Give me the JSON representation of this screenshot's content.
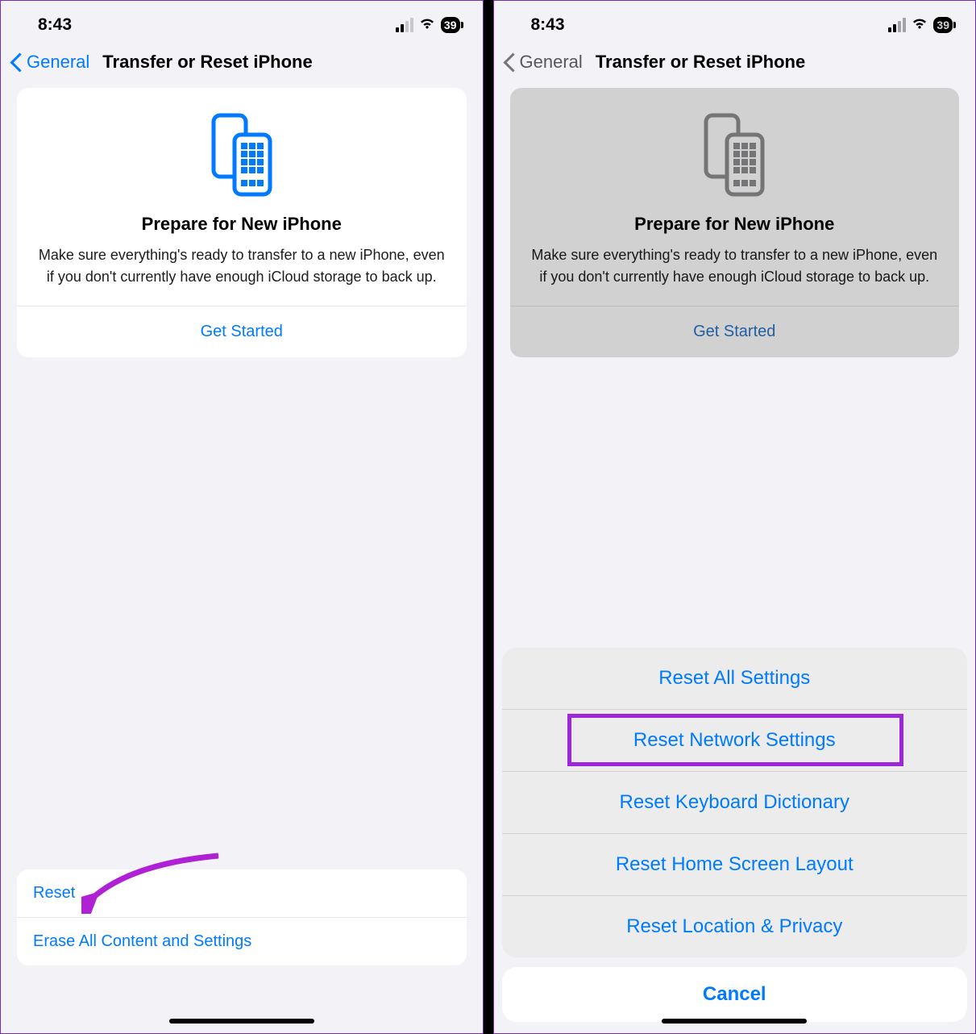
{
  "status": {
    "time": "8:43",
    "battery": "39"
  },
  "nav": {
    "back": "General",
    "title": "Transfer or Reset iPhone"
  },
  "card": {
    "title": "Prepare for New iPhone",
    "body": "Make sure everything's ready to transfer to a new iPhone, even if you don't currently have enough iCloud storage to back up.",
    "action": "Get Started"
  },
  "bottom": {
    "reset": "Reset",
    "erase": "Erase All Content and Settings"
  },
  "sheet": {
    "options": [
      "Reset All Settings",
      "Reset Network Settings",
      "Reset Keyboard Dictionary",
      "Reset Home Screen Layout",
      "Reset Location & Privacy"
    ],
    "cancel": "Cancel",
    "highlighted_index": 1
  }
}
